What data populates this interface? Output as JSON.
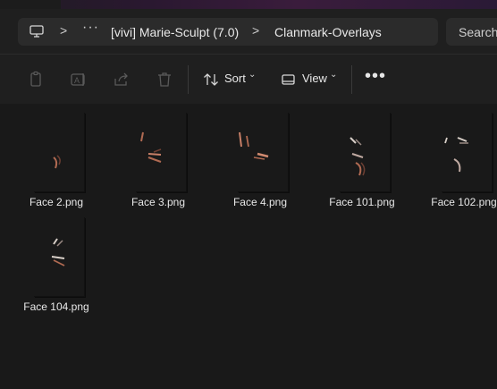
{
  "breadcrumb": {
    "more_label": "···",
    "items": [
      "[vivi] Marie-Sculpt (7.0)",
      "Clanmark-Overlays"
    ],
    "separator": ">"
  },
  "search": {
    "placeholder": "Search"
  },
  "toolbar": {
    "sort_label": "Sort",
    "view_label": "View",
    "more_label": "•••",
    "caret": "⌄",
    "icons": [
      "copy-icon",
      "rename-icon",
      "share-icon",
      "delete-icon",
      "sort-icon",
      "view-icon"
    ]
  },
  "files": [
    {
      "name": "Face 2.png"
    },
    {
      "name": "Face 3.png"
    },
    {
      "name": "Face 4.png"
    },
    {
      "name": "Face 101.png"
    },
    {
      "name": "Face 102.png"
    },
    {
      "name": "Face 104.png"
    }
  ],
  "colors": {
    "background": "#191919",
    "toolbar": "#1f1f1f",
    "field": "#2b2b2b",
    "thumb_mark_warm": "#b06a52",
    "thumb_mark_light": "#d8cfc8"
  }
}
